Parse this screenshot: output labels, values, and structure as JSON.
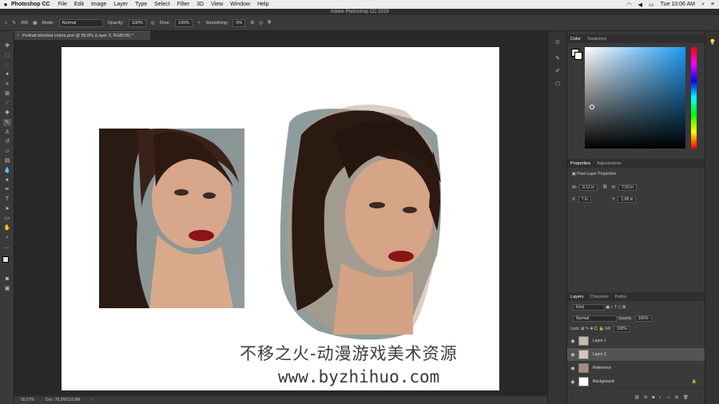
{
  "menubar": {
    "app_name": "Photoshop CC",
    "items": [
      "File",
      "Edit",
      "Image",
      "Layer",
      "Type",
      "Select",
      "Filter",
      "3D",
      "View",
      "Window",
      "Help"
    ],
    "clock": "Tue 10:06 AM"
  },
  "window_title": "Adobe Photoshop CC 2019",
  "options_bar": {
    "brush_size": "200",
    "mode_label": "Mode:",
    "mode_value": "Normal",
    "opacity_label": "Opacity:",
    "opacity_value": "100%",
    "flow_label": "Flow:",
    "flow_value": "100%",
    "smoothing_label": "Smoothing:",
    "smoothing_value": "0%"
  },
  "document_tab": "Portrait blocked colors.psd @ 55.6% (Layer 2, RGB/16) *",
  "status_bar": {
    "zoom": "55.57%",
    "doc_size": "Doc: 78.2M/153.8M"
  },
  "watermark": {
    "line1": "不移之火-动漫游戏美术资源",
    "line2": "www.byzhihuo.com"
  },
  "color_panel": {
    "tabs": [
      "Color",
      "Swatches"
    ]
  },
  "properties_panel": {
    "tabs": [
      "Properties",
      "Adjustments"
    ],
    "heading": "Pixel Layer Properties",
    "w_label": "W:",
    "w_value": "9.12 in",
    "h_label": "H:",
    "h_value": "7.53 in",
    "x_label": "X:",
    "x_value": "7 in",
    "y_label": "Y:",
    "y_value": "1.08 in"
  },
  "layers_panel": {
    "tabs": [
      "Layers",
      "Channels",
      "Paths"
    ],
    "filter_value": "Kind",
    "blend_mode": "Normal",
    "opacity_label": "Opacity:",
    "opacity_value": "100%",
    "lock_label": "Lock:",
    "fill_label": "Fill:",
    "fill_value": "100%",
    "layers": [
      {
        "name": "Layer 1"
      },
      {
        "name": "Layer 2"
      },
      {
        "name": "Reference"
      },
      {
        "name": "Background"
      }
    ]
  },
  "colors": {
    "canvas_bg": "#ffffff",
    "foreground_swatch": "#e0e0e0",
    "background_swatch": "#ffffff"
  }
}
